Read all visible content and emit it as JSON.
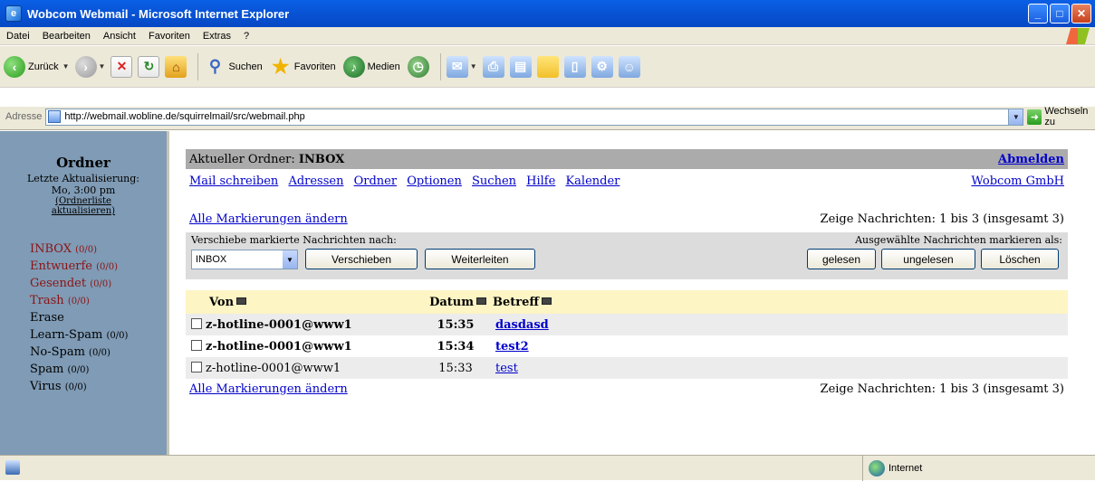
{
  "window": {
    "title": "Wobcom Webmail - Microsoft Internet Explorer"
  },
  "menu": [
    "Datei",
    "Bearbeiten",
    "Ansicht",
    "Favoriten",
    "Extras",
    "?"
  ],
  "toolbar": {
    "back": "Zurück",
    "search": "Suchen",
    "favorites": "Favoriten",
    "media": "Medien"
  },
  "address": {
    "label": "Adresse",
    "url": "http://webmail.wobline.de/squirrelmail/src/webmail.php",
    "go": "Wechseln zu"
  },
  "sidebar": {
    "title": "Ordner",
    "last_update_label": "Letzte Aktualisierung:",
    "last_update_time": "Mo, 3:00 pm",
    "refresh_link_1": "(Ordnerliste",
    "refresh_link_2": "aktualisieren)",
    "folders": [
      {
        "name": "INBOX",
        "count": "(0/0)"
      },
      {
        "name": "Entwuerfe",
        "count": "(0/0)"
      },
      {
        "name": "Gesendet",
        "count": "(0/0)"
      },
      {
        "name": "Trash",
        "count": "(0/0)"
      },
      {
        "name": "Erase",
        "count": ""
      },
      {
        "name": "Learn-Spam",
        "count": "(0/0)"
      },
      {
        "name": "No-Spam",
        "count": "(0/0)"
      },
      {
        "name": "Spam",
        "count": "(0/0)"
      },
      {
        "name": "Virus",
        "count": "(0/0)"
      }
    ]
  },
  "header": {
    "current_folder_label": "Aktueller Ordner:",
    "current_folder": "INBOX",
    "logout": "Abmelden",
    "company": "Wobcom GmbH",
    "nav": [
      "Mail schreiben",
      "Adressen",
      "Ordner",
      "Optionen",
      "Suchen",
      "Hilfe",
      "Kalender"
    ]
  },
  "list": {
    "toggle_all": "Alle Markierungen ändern",
    "showing": "Zeige Nachrichten: 1 bis 3 (insgesamt 3)",
    "move_label": "Verschiebe markierte Nachrichten nach:",
    "mark_label": "Ausgewählte Nachrichten markieren als:",
    "move_target": "INBOX",
    "move_button": "Verschieben",
    "forward_button": "Weiterleiten",
    "read_button": "gelesen",
    "unread_button": "ungelesen",
    "delete_button": "Löschen",
    "columns": {
      "from": "Von",
      "date": "Datum",
      "subject": "Betreff"
    },
    "messages": [
      {
        "from": "z-hotline-0001@www1",
        "date": "15:35",
        "subject": "dasdasd",
        "unread": true
      },
      {
        "from": "z-hotline-0001@www1",
        "date": "15:34",
        "subject": "test2",
        "unread": true
      },
      {
        "from": "z-hotline-0001@www1",
        "date": "15:33",
        "subject": "test",
        "unread": false
      }
    ]
  },
  "status": {
    "zone": "Internet"
  }
}
